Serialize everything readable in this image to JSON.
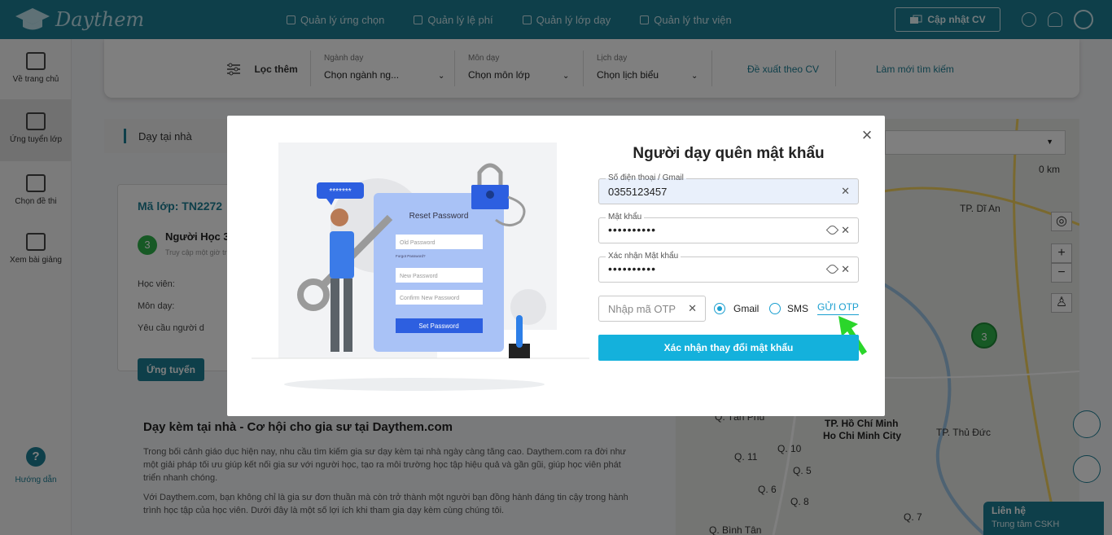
{
  "header": {
    "logo": "Daythem",
    "nav": [
      "Quản lý ứng chọn",
      "Quản lý lệ phí",
      "Quản lý lớp dạy",
      "Quản lý thư viện"
    ],
    "cv_button": "Cập nhật CV"
  },
  "sidebar": {
    "items": [
      {
        "label": "Về trang chủ",
        "icon": "home-icon"
      },
      {
        "label": "Ứng tuyển lớp",
        "icon": "group-icon"
      },
      {
        "label": "Chọn đề thi",
        "icon": "list-icon"
      },
      {
        "label": "Xem bài giảng",
        "icon": "lecture-icon"
      }
    ],
    "help": "Hướng dẫn"
  },
  "filter": {
    "label": "Lọc thêm",
    "field1_label": "Ngành dạy",
    "field1_value": "Chọn ngành ng...",
    "field2_label": "Môn dạy",
    "field2_value": "Chọn môn lớp",
    "field3_label": "Lịch dạy",
    "field3_value": "Chọn lịch biểu",
    "suggest": "Đề xuất theo CV",
    "refresh": "Làm mới tìm kiếm"
  },
  "content": {
    "tab": "Dạy tại nhà",
    "card_code": "Mã lớp: TN2272",
    "card_badge": "3",
    "card_name": "Người Học 3",
    "card_sub": "Truy cập một giờ tr",
    "row1": "Học viên:",
    "row2": "Môn dạy:",
    "row3": "Yêu cầu người d",
    "apply": "Ứng tuyển",
    "article_title": "Dạy kèm tại nhà - Cơ hội cho gia sư tại Daythem.com",
    "article_p1": "Trong bối cảnh giáo dục hiện nay, nhu cầu tìm kiếm gia sư dạy kèm tại nhà ngày càng tăng cao. Daythem.com ra đời như một giải pháp tối ưu giúp kết nối gia sư với người học, tạo ra môi trường học tập hiệu quả và gần gũi, giúp học viên phát triển nhanh chóng.",
    "article_p2": "Với Daythem.com, bạn không chỉ là gia sư đơn thuần mà còn trở thành một người bạn đồng hành đáng tin cậy trong hành trình học tập của học viên. Dưới đây là một số lợi ích khi tham gia dạy kèm cùng chúng tôi."
  },
  "map": {
    "labels": [
      "TP. Dĩ An",
      "Q. Tân Phú",
      "Q. 10",
      "Q. 11",
      "Q. 5",
      "Q. 6",
      "Q. 8",
      "Q. Bình Tân",
      "Q. 7",
      "TP. Thủ Đức",
      "0 km"
    ],
    "city_vi": "TP. Hồ Chí Minh",
    "city_en": "Ho Chi Minh City",
    "marker": "3",
    "zoom_in": "+",
    "zoom_out": "−"
  },
  "contact": {
    "title": "Liên hệ",
    "sub": "Trung tâm CSKH"
  },
  "modal": {
    "title": "Người dạy quên mật khẩu",
    "phone_label": "Số điện thoại / Gmail",
    "phone_value": "0355123457",
    "pw_label": "Mật khẩu",
    "pw_value": "••••••••••",
    "confirm_label": "Xác nhận Mật khẩu",
    "confirm_value": "••••••••••",
    "otp_placeholder": "Nhập mã OTP",
    "gmail": "Gmail",
    "sms": "SMS",
    "send_otp": "GỬI OTP",
    "submit": "Xác nhận thay đổi mật khẩu",
    "close": "×",
    "illus_title": "Reset Password",
    "illus_old": "Old Password",
    "illus_forgot": "Forgot Password?",
    "illus_new": "New Password",
    "illus_confirm": "Confirm New Password",
    "illus_button": "Set Password",
    "illus_bubble": "*******"
  },
  "colors": {
    "brand": "#1d7f95",
    "accent": "#14b1dc",
    "arrow": "#2bd62b"
  }
}
